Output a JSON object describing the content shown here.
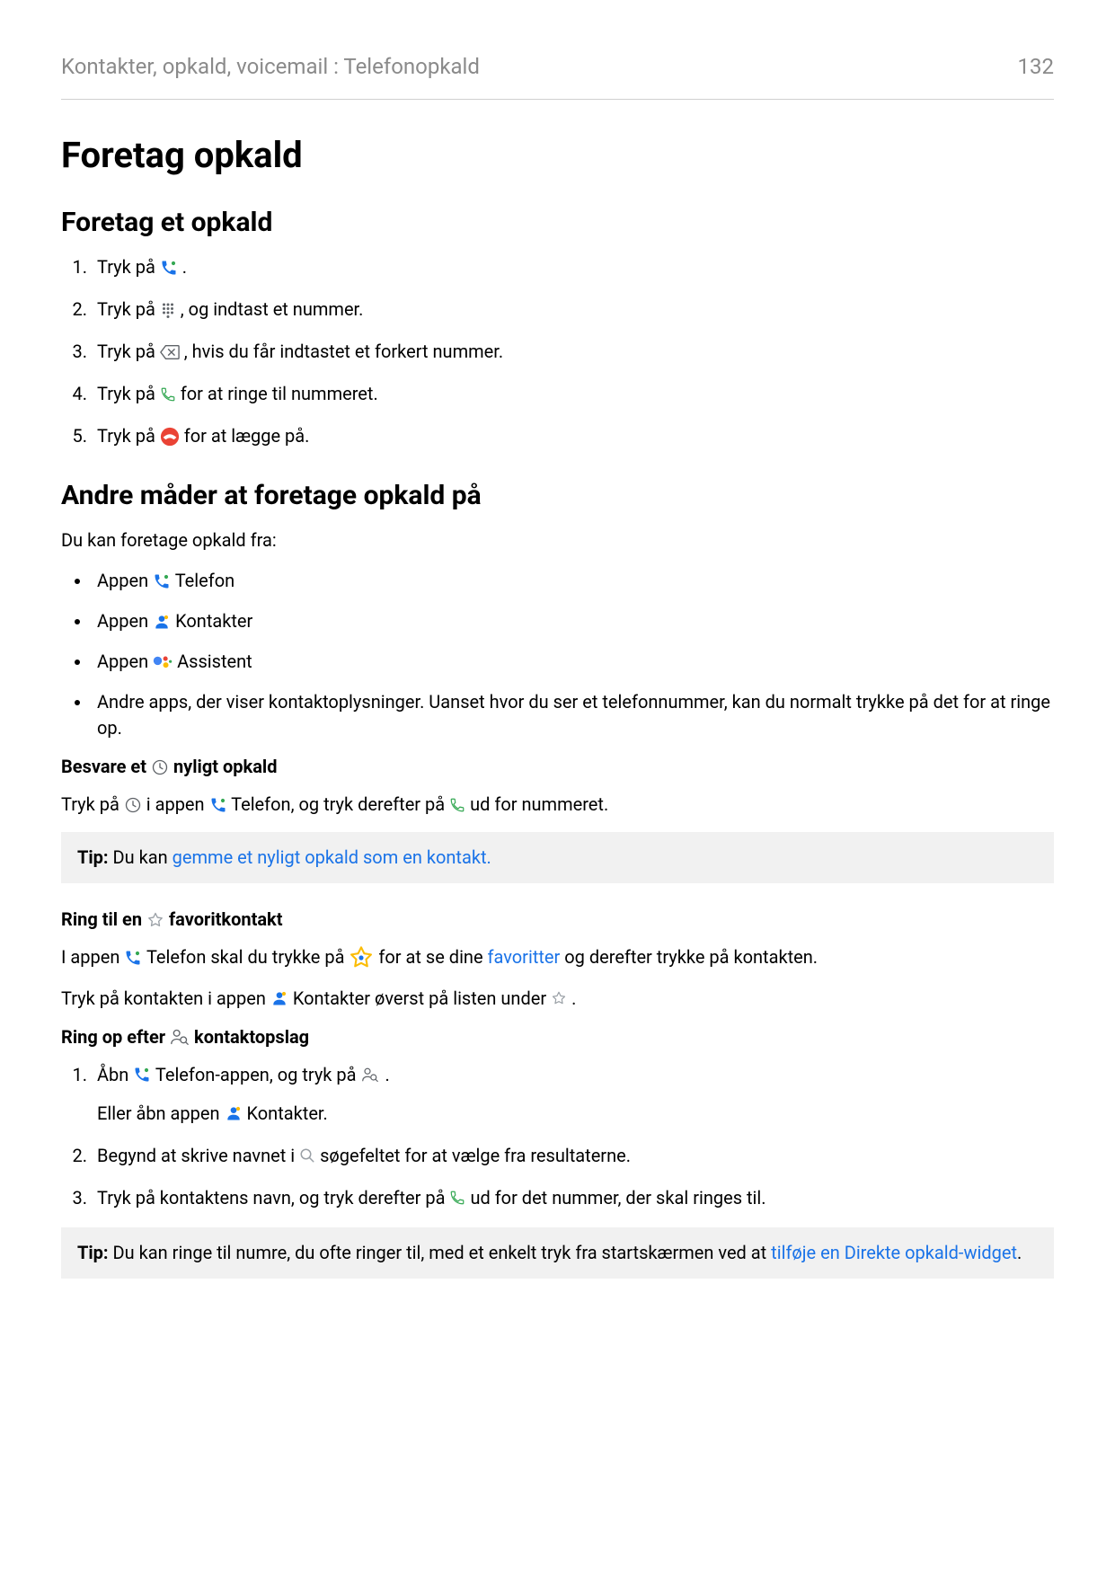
{
  "header": {
    "breadcrumb": "Kontakter, opkald, voicemail : Telefonopkald",
    "page_number": "132"
  },
  "title": "Foretag opkald",
  "section1": {
    "heading": "Foretag et opkald",
    "steps": {
      "s1_a": "Tryk på ",
      "s1_b": ".",
      "s2_a": "Tryk på ",
      "s2_b": ", og indtast et nummer.",
      "s3_a": "Tryk på ",
      "s3_b": ", hvis du får indtastet et forkert nummer.",
      "s4_a": "Tryk på ",
      "s4_b": " for at ringe til nummeret.",
      "s5_a": "Tryk på ",
      "s5_b": " for at lægge på."
    }
  },
  "section2": {
    "heading": "Andre måder at foretage opkald på",
    "intro": "Du kan foretage opkald fra:",
    "bullets": {
      "b1_a": "Appen ",
      "b1_b": " Telefon",
      "b2_a": "Appen ",
      "b2_b": " Kontakter",
      "b3_a": "Appen ",
      "b3_b": " Assistent",
      "b4": "Andre apps, der viser kontaktoplysninger. Uanset hvor du ser et telefonnummer, kan du normalt trykke på det for at ringe op."
    },
    "sub1": {
      "heading_a": "Besvare et ",
      "heading_b": " nyligt opkald",
      "p1_a": "Tryk på ",
      "p1_b": " i appen ",
      "p1_c": " Telefon, og tryk derefter på ",
      "p1_d": " ud for nummeret."
    },
    "tip1_label": "Tip:",
    "tip1_before": " Du kan ",
    "tip1_link": "gemme et nyligt opkald som en kontakt.",
    "sub2": {
      "heading_a": "Ring til en ",
      "heading_b": " favoritkontakt",
      "p1_a": "I appen ",
      "p1_b": " Telefon skal du trykke på ",
      "p1_c": " for at se dine ",
      "p1_link": "favoritter",
      "p1_d": " og derefter trykke på kontakten.",
      "p2_a": "Tryk på kontakten i appen ",
      "p2_b": " Kontakter øverst på listen under ",
      "p2_c": "."
    },
    "sub3": {
      "heading_a": "Ring op efter ",
      "heading_b": " kontaktopslag",
      "s1_a": "Åbn ",
      "s1_b": " Telefon-appen, og tryk på ",
      "s1_c": ".",
      "s1_d": "Eller åbn appen ",
      "s1_e": " Kontakter.",
      "s2_a": "Begynd at skrive navnet i ",
      "s2_b": " søgefeltet for at vælge fra resultaterne.",
      "s3_a": "Tryk på kontaktens navn, og tryk derefter på ",
      "s3_b": " ud for det nummer, der skal ringes til."
    },
    "tip2_label": "Tip:",
    "tip2_before": " Du kan ringe til numre, du ofte ringer til, med et enkelt tryk fra startskærmen ved at ",
    "tip2_link": "tilføje en Direkte opkald-widget",
    "tip2_after": "."
  }
}
